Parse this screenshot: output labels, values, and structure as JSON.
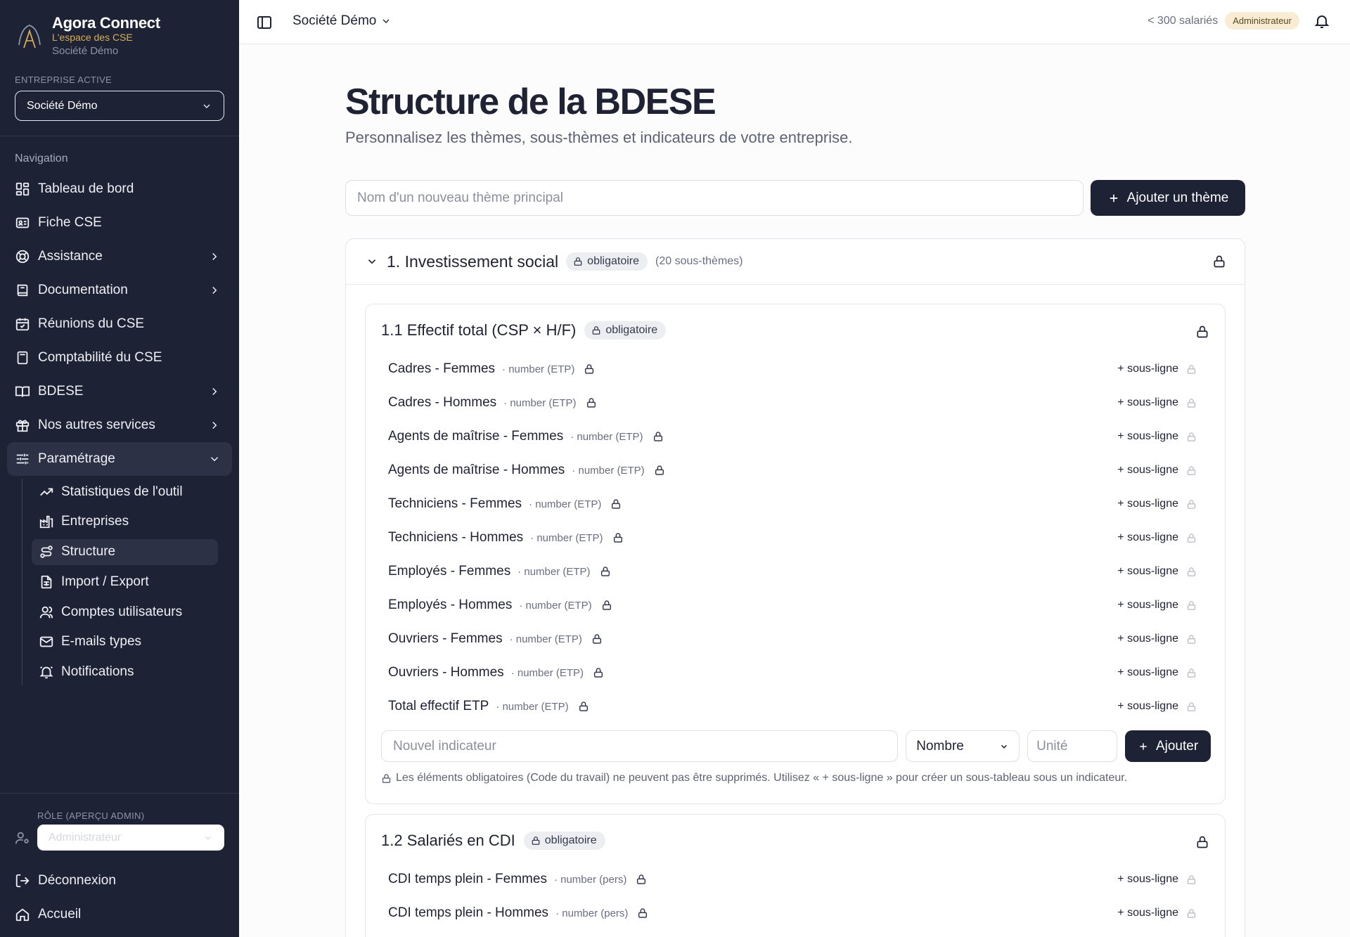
{
  "brand": {
    "name": "Agora Connect",
    "tagline": "L'espace des CSE",
    "company": "Société Démo"
  },
  "colors": {
    "sidebar_bg": "#1e2235",
    "accent_gold": "#d9ad52",
    "primary_button": "#1e2235"
  },
  "sidebar": {
    "active_company_label": "ENTREPRISE ACTIVE",
    "active_company_value": "Société Démo",
    "nav_title": "Navigation",
    "items": [
      {
        "label": "Tableau de bord",
        "icon": "dashboard-icon"
      },
      {
        "label": "Fiche CSE",
        "icon": "id-card-icon"
      },
      {
        "label": "Assistance",
        "icon": "lifebuoy-icon",
        "expandable": true
      },
      {
        "label": "Documentation",
        "icon": "book-icon",
        "expandable": true
      },
      {
        "label": "Réunions du CSE",
        "icon": "calendar-icon"
      },
      {
        "label": "Comptabilité du CSE",
        "icon": "calculator-icon"
      },
      {
        "label": "BDESE",
        "icon": "open-book-icon",
        "expandable": true
      },
      {
        "label": "Nos autres services",
        "icon": "gift-icon",
        "expandable": true
      },
      {
        "label": "Paramétrage",
        "icon": "sliders-icon",
        "expanded": true
      }
    ],
    "sub_items": [
      {
        "label": "Statistiques de l'outil",
        "icon": "trending-up-icon"
      },
      {
        "label": "Entreprises",
        "icon": "factory-icon"
      },
      {
        "label": "Structure",
        "icon": "route-icon",
        "active": true
      },
      {
        "label": "Import / Export",
        "icon": "file-spreadsheet-icon"
      },
      {
        "label": "Comptes utilisateurs",
        "icon": "users-icon"
      },
      {
        "label": "E-mails types",
        "icon": "mail-icon"
      },
      {
        "label": "Notifications",
        "icon": "bell-ring-icon"
      }
    ],
    "role_label": "RÔLE (APERÇU ADMIN)",
    "role_value": "Administrateur",
    "footer": [
      {
        "label": "Déconnexion",
        "icon": "logout-icon"
      },
      {
        "label": "Accueil",
        "icon": "home-icon"
      }
    ]
  },
  "topbar": {
    "company": "Société Démo",
    "employees": "< 300 salariés",
    "role_badge": "Administrateur"
  },
  "main": {
    "title": "Structure de la BDESE",
    "subtitle": "Personnalisez les thèmes, sous-thèmes et indicateurs de votre entreprise.",
    "theme_input_placeholder": "Nom d'un nouveau thème principal",
    "add_theme_label": "Ajouter un thème",
    "theme": {
      "title": "1. Investissement social",
      "badge": "obligatoire",
      "count": "(20 sous-thèmes)"
    },
    "subthemes": [
      {
        "title": "1.1 Effectif total (CSP × H/F)",
        "badge": "obligatoire",
        "indicators": [
          {
            "label": "Cadres - Femmes",
            "meta": "· number (ETP)"
          },
          {
            "label": "Cadres - Hommes",
            "meta": "· number (ETP)"
          },
          {
            "label": "Agents de maîtrise - Femmes",
            "meta": "· number (ETP)"
          },
          {
            "label": "Agents de maîtrise - Hommes",
            "meta": "· number (ETP)"
          },
          {
            "label": "Techniciens - Femmes",
            "meta": "· number (ETP)"
          },
          {
            "label": "Techniciens - Hommes",
            "meta": "· number (ETP)"
          },
          {
            "label": "Employés - Femmes",
            "meta": "· number (ETP)"
          },
          {
            "label": "Employés - Hommes",
            "meta": "· number (ETP)"
          },
          {
            "label": "Ouvriers - Femmes",
            "meta": "· number (ETP)"
          },
          {
            "label": "Ouvriers - Hommes",
            "meta": "· number (ETP)"
          },
          {
            "label": "Total effectif ETP",
            "meta": "· number (ETP)"
          }
        ]
      },
      {
        "title": "1.2 Salariés en CDI",
        "badge": "obligatoire",
        "indicators": [
          {
            "label": "CDI temps plein - Femmes",
            "meta": "· number (pers)"
          },
          {
            "label": "CDI temps plein - Hommes",
            "meta": "· number (pers)"
          }
        ]
      }
    ],
    "sub_line_label": "+ sous-ligne",
    "indicator_placeholder": "Nouvel indicateur",
    "type_value": "Nombre",
    "unit_placeholder": "Unité",
    "add_indicator_label": "Ajouter",
    "hint": "Les éléments obligatoires (Code du travail) ne peuvent pas être supprimés. Utilisez « + sous-ligne » pour créer un sous-tableau sous un indicateur."
  }
}
